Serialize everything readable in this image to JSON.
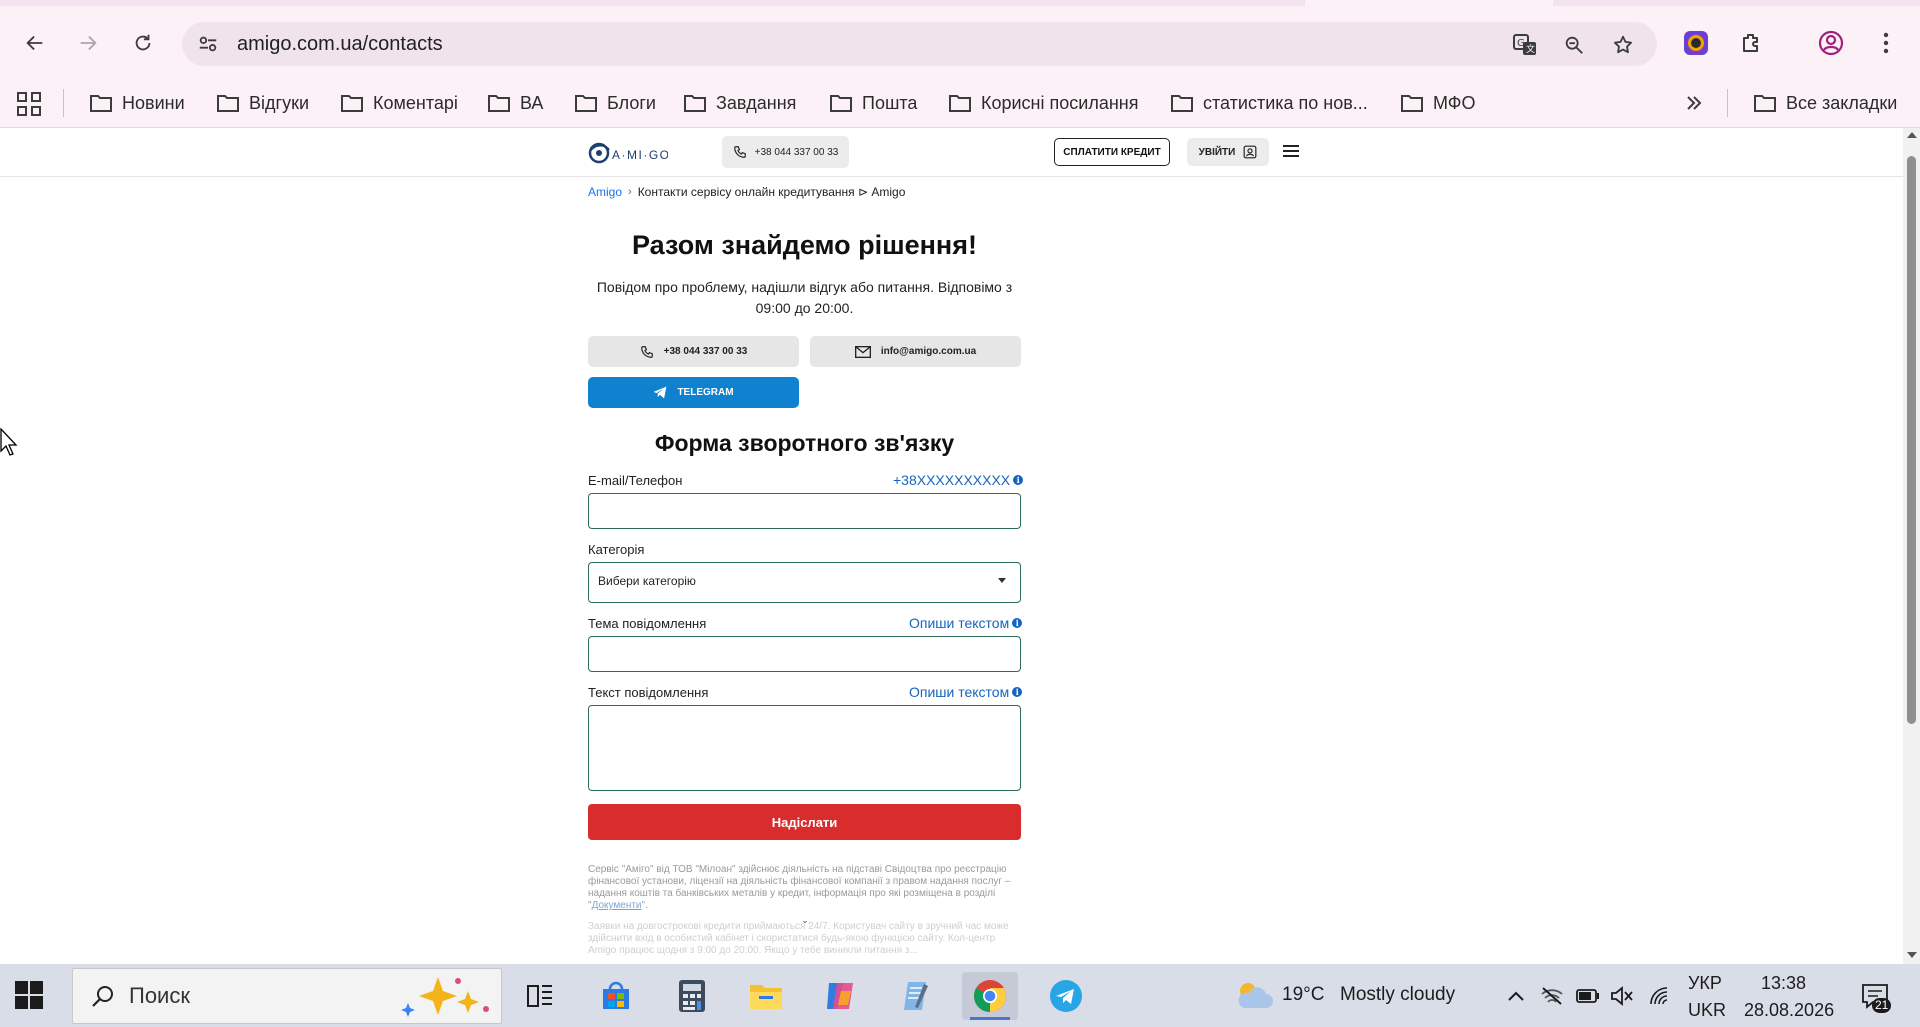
{
  "browser": {
    "url": "amigo.com.ua/contacts",
    "bookmarks": [
      "Новини",
      "Відгуки",
      "Коментарі",
      "ВА",
      "Блоги",
      "Завдання",
      "Пошта",
      "Корисні посилання",
      "статистика по нов...",
      "МФО"
    ],
    "all_bookmarks": "Все закладки"
  },
  "site": {
    "logo_text": "A·MI·GO",
    "phone": "+38 044 337 00 33",
    "pay_credit": "СПЛАТИТИ КРЕДИТ",
    "login": "УВІЙТИ"
  },
  "breadcrumb": {
    "home": "Amigo",
    "current": "Контакти сервісу онлайн кредитування ⊳ Amigo"
  },
  "hero": {
    "title": "Разом знайдемо рішення!",
    "subtitle": "Повідом про проблему, надішли відгук або питання. Відповімо з 09:00 до 20:00."
  },
  "contacts": {
    "phone": "+38 044 337 00 33",
    "email": "info@amigo.com.ua",
    "telegram": "TELEGRAM"
  },
  "form": {
    "title": "Форма зворотного зв'язку",
    "contact_label": "E-mail/Телефон",
    "contact_hint": "+38XXXXXXXXXX",
    "contact_value": "",
    "category_label": "Категорія",
    "category_value": "Вибери категорію",
    "subject_label": "Тема повідомлення",
    "subject_hint": "Опиши текстом",
    "subject_value": "",
    "message_label": "Текст повідомлення",
    "message_hint": "Опиши текстом",
    "message_value": "",
    "submit": "Надіслати"
  },
  "legal": {
    "p1_text": "Сервіс \"Аміго\" від ТОВ \"Мілоан\" здійснює діяльність на підставі Свідоцтва про реєстрацію фінансової установи, ліцензії на діяльність фінансової компанії з правом надання послуг – надання коштів та банківських металів у кредит, інформація про які розміщена в розділі \"",
    "p1_link": "Документи",
    "p1_end": "\".",
    "p2_text": "Заявки на довгострокові кредити приймаються 24/7. Користувач сайту в зручний час може здійснити вхід в особистий кабінет і скористатися будь-якою функцією сайту. Кол-центр Amigo працює щодня з 9:00 до 20:00. Якщо у тебе виникли питання з..."
  },
  "taskbar": {
    "search": "Поиск",
    "weather_temp": "19°C",
    "weather_desc": "Mostly cloudy",
    "lang_top": "УКР",
    "lang_bottom": "UKR",
    "time": "13:38",
    "date": "28.08.2026",
    "notifications": "21"
  },
  "colors": {
    "accent_blue": "#1565c0",
    "telegram_blue": "#1081cf",
    "submit_red": "#d92d2d",
    "chrome_pink": "#fdf1f8"
  }
}
